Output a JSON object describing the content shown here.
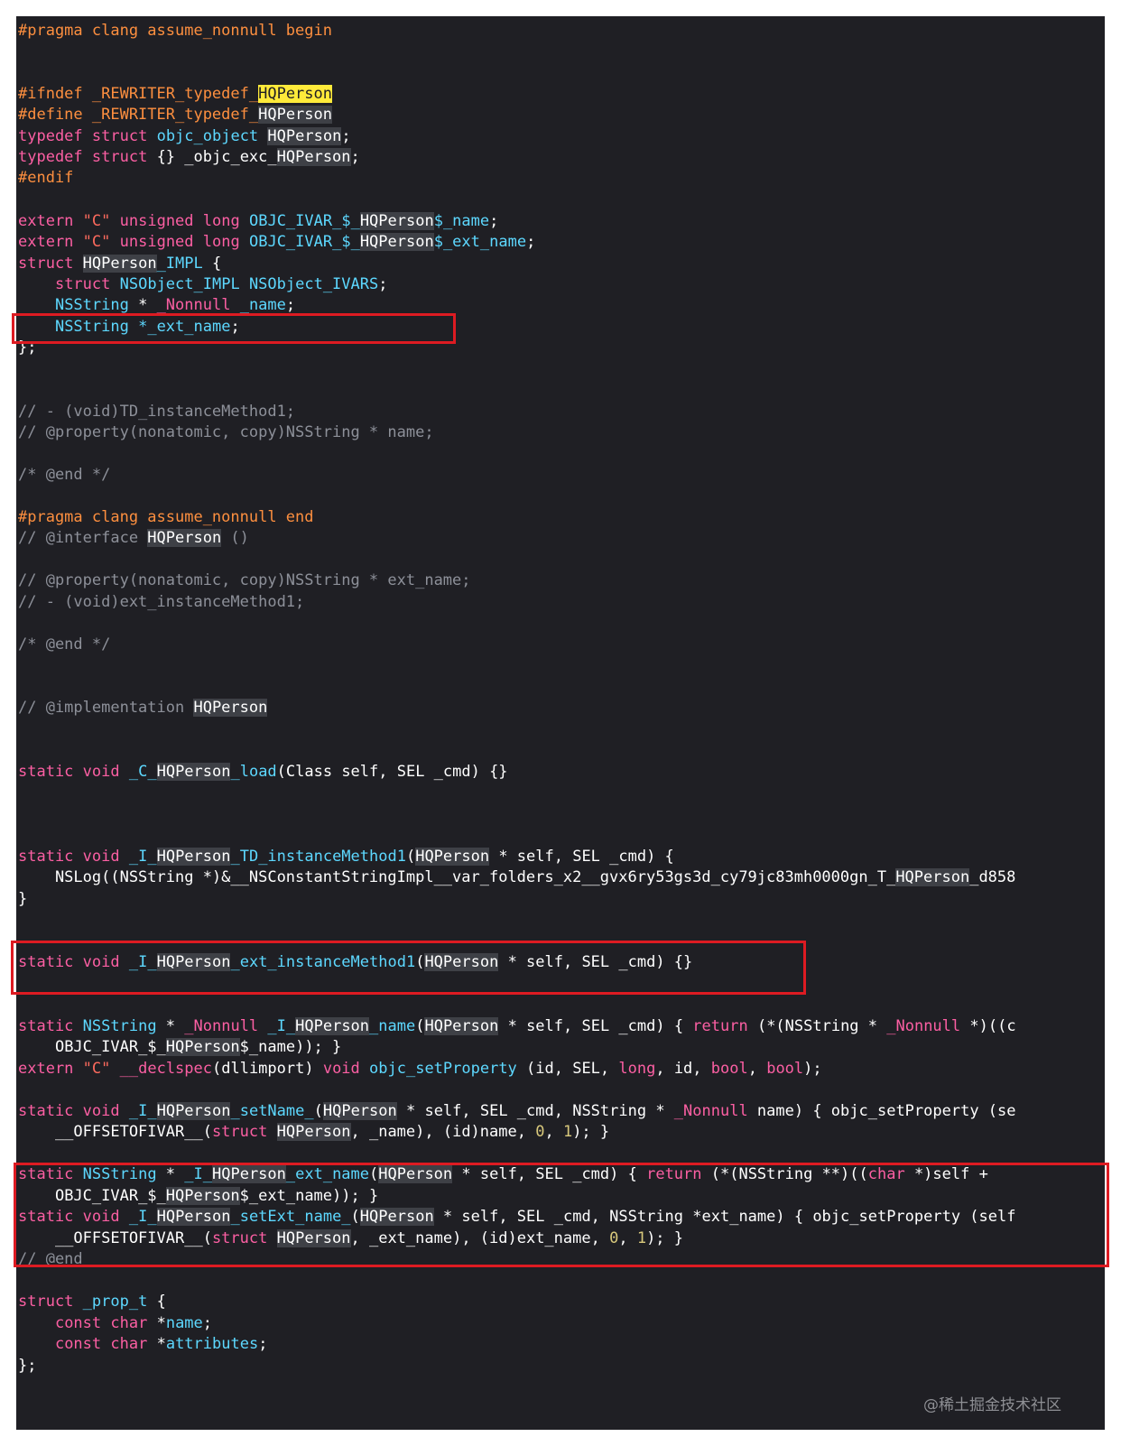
{
  "code": {
    "pragma_begin": "#pragma clang assume_nonnull begin",
    "ifndef": "#ifndef _REWRITER_typedef_",
    "define": "#define _REWRITER_typedef_",
    "cls": "HQPerson",
    "kw_typedef": "typedef",
    "kw_struct": "struct",
    "objc_object": "objc_object",
    "objc_exc": "_objc_exc_",
    "endif": "#endif",
    "kw_extern": "extern",
    "str_c": "\"C\"",
    "kw_unsigned": "unsigned",
    "kw_long": "long",
    "ivar_prefix": "OBJC_IVAR_$_",
    "ivar_name_suffix": "$_name",
    "ivar_ext_suffix": "$_ext_name",
    "impl_suffix": "_IMPL",
    "nsobject_impl": "NSObject_IMPL",
    "nsobject_ivars": "NSObject_IVARS",
    "nsstring": "NSString",
    "nonnull": "_Nonnull",
    "field_name": "_name",
    "field_ext_name": "*_ext_name",
    "close_brace_semicolon": "};",
    "comment_td_method": "// - (void)TD_instanceMethod1;",
    "comment_prop_name": "// @property(nonatomic, copy)NSString * name;",
    "comment_end": "/* @end */",
    "pragma_end": "#pragma clang assume_nonnull end",
    "comment_interface": "// @interface ",
    "comment_interface_tail": " ()",
    "comment_prop_ext": "// @property(nonatomic, copy)NSString * ext_name;",
    "comment_ext_method": "// - (void)ext_instanceMethod1;",
    "comment_impl": "// @implementation ",
    "kw_static": "static",
    "kw_void": "void",
    "c_prefix": "_C_",
    "load": "_load",
    "load_args": "(Class self, SEL _cmd) {}",
    "i_prefix": "_I_",
    "td_method": "_TD_instanceMethod1",
    "self_cmd_open": " * self, SEL _cmd) {",
    "nslog_line": "    NSLog((NSString *)&__NSConstantStringImpl__var_folders_x2__gvx6ry53gs3d_cy79jc83mh0000gn_T_",
    "nslog_tail": "_d858",
    "ext_method": "_ext_instanceMethod1",
    "self_cmd_empty": " * self, SEL _cmd) {}",
    "getter_name": "_name",
    "getter_mid": " * self, SEL _cmd) { ",
    "kw_return": "return",
    "cast_nonnull": " (*(NSString * ",
    "cast_tail": " *)((c",
    "ivar_ret_name": "$_name)); }",
    "declspec": "__declspec",
    "dllimport": "(dllimport) ",
    "set_property": "objc_setProperty",
    "set_property_args": " (id, SEL, ",
    "kw_bool": "bool",
    "setter_name": "_setName_",
    "setter_mid": " * self, SEL _cmd, NSString * ",
    "setter_tail": " name) { objc_setProperty (se",
    "offsetof": "    __OFFSETOFIVAR__(",
    "offset_name": ", _name), (id)name, ",
    "zero": "0",
    "one": "1",
    "close_call": "); }",
    "getter_ext": "_ext_name",
    "cast_ptr": " (*(NSString **)((",
    "kw_char": "char",
    "self_plus": " *)self +",
    "ivar_ret_ext": "$_ext_name)); }",
    "setter_ext": "_setExt_name_",
    "setter_ext_tail": " * self, SEL _cmd, NSString *ext_name) { objc_setProperty (self",
    "offset_ext": ", _ext_name), (id)ext_name, ",
    "comment_at_end": "// @end",
    "prop_t": "_prop_t",
    "kw_const": "const",
    "attr_name": "name",
    "attr_attributes": "attributes"
  },
  "watermark": "@稀土掘金技术社区",
  "colors": {
    "background": "#1f1f24",
    "keyword": "#fc5fa3",
    "preprocessor": "#fd8f3f",
    "type": "#5dd8ff",
    "comment": "#8d9099",
    "string": "#fc6a5d",
    "highlight_box": "#dd1b22",
    "search_match": "#ffea3a"
  }
}
